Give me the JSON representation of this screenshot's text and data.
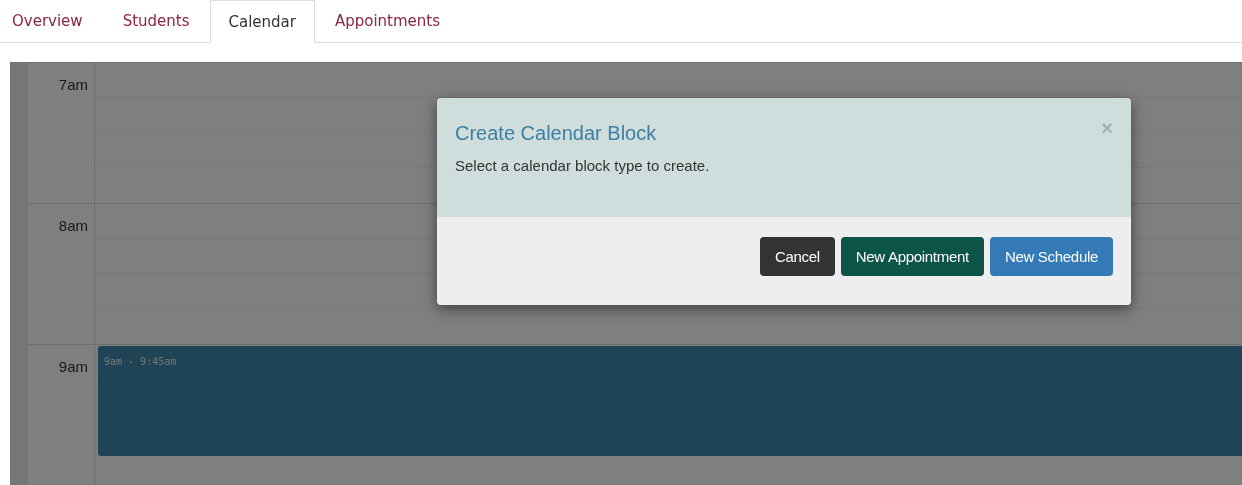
{
  "tabs": [
    {
      "label": "Overview",
      "selected": false
    },
    {
      "label": "Students",
      "selected": false
    },
    {
      "label": "Calendar",
      "selected": true
    },
    {
      "label": "Appointments",
      "selected": false
    }
  ],
  "calendar": {
    "hours": [
      {
        "label": "7am"
      },
      {
        "label": "8am"
      },
      {
        "label": "9am",
        "event": {
          "time": "9am - 9:45am"
        }
      }
    ]
  },
  "modal": {
    "title": "Create Calendar Block",
    "message": "Select a calendar block type to create.",
    "close": "×",
    "buttons": [
      {
        "label": "Cancel",
        "kind": "dark"
      },
      {
        "label": "New Appointment",
        "kind": "green"
      },
      {
        "label": "New Schedule",
        "kind": "blue"
      }
    ]
  }
}
